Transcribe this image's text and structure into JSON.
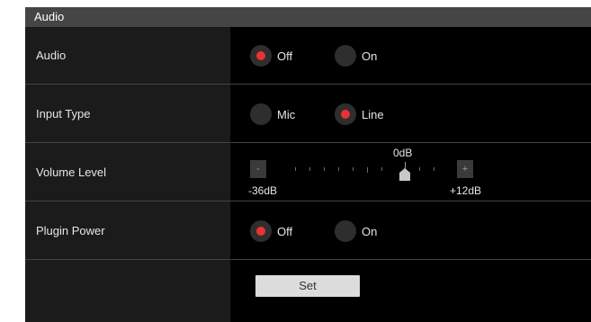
{
  "panel": {
    "title": "Audio"
  },
  "colors": {
    "selected_dot": "#e8342e",
    "background": "#000000",
    "label_column": "#1b1b1b",
    "header": "#454545"
  },
  "rows": {
    "audio": {
      "label": "Audio",
      "options": [
        {
          "label": "Off",
          "selected": true
        },
        {
          "label": "On",
          "selected": false
        }
      ]
    },
    "input_type": {
      "label": "Input Type",
      "options": [
        {
          "label": "Mic",
          "selected": false
        },
        {
          "label": "Line",
          "selected": true
        }
      ]
    },
    "volume_level": {
      "label": "Volume Level",
      "minus_label": "-",
      "plus_label": "+",
      "min_label": "-36dB",
      "max_label": "+12dB",
      "marker_label": "0dB",
      "min_value_db": -36,
      "max_value_db": 12,
      "value_db": 0
    },
    "plugin_power": {
      "label": "Plugin Power",
      "options": [
        {
          "label": "Off",
          "selected": true
        },
        {
          "label": "On",
          "selected": false
        }
      ]
    }
  },
  "set_button": {
    "label": "Set"
  }
}
